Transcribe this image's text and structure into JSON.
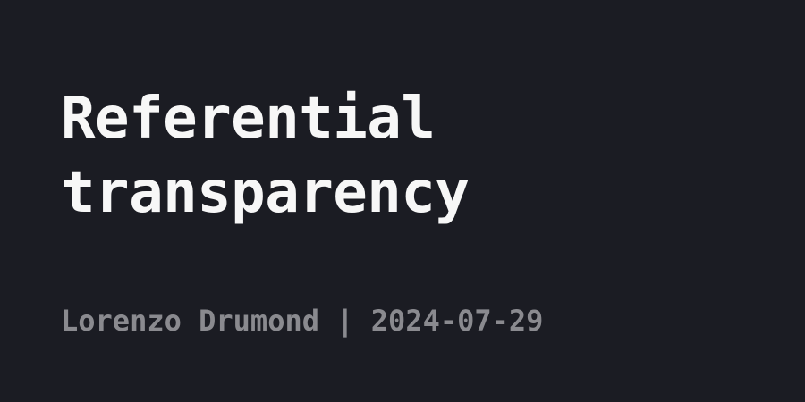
{
  "card": {
    "title": "Referential transparency",
    "meta": "Lorenzo Drumond | 2024-07-29"
  },
  "colors": {
    "background": "#1b1c23",
    "title": "#f7f7f7",
    "meta": "#8a8a8f"
  }
}
